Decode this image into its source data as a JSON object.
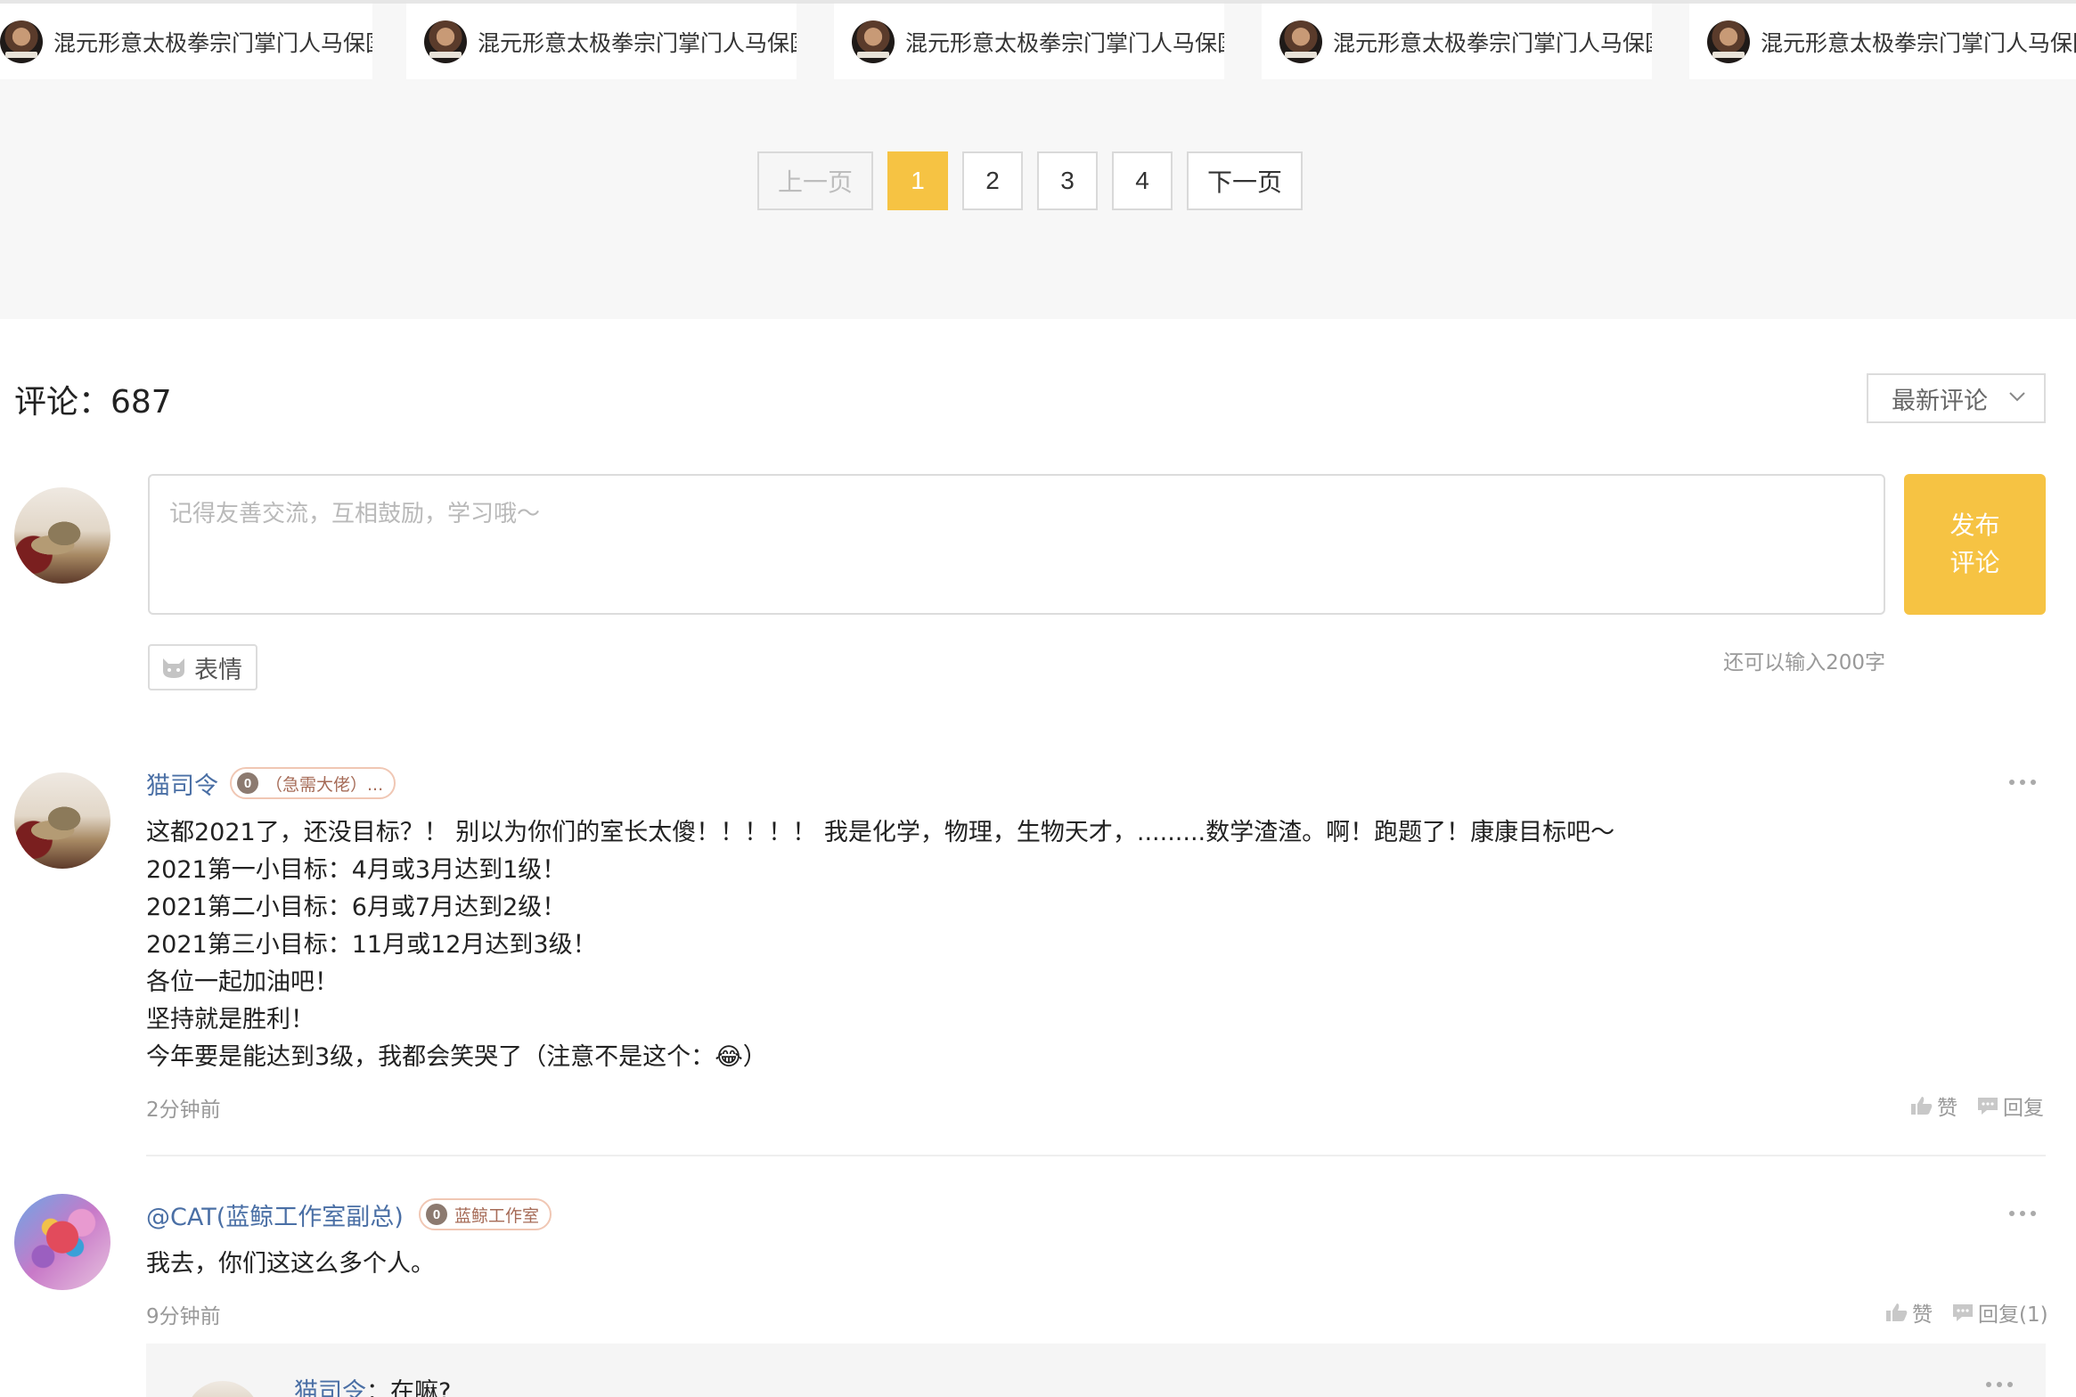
{
  "video_list": {
    "items": [
      {
        "title": "混元形意太极拳宗门掌门人马保国"
      },
      {
        "title": "混元形意太极拳宗门掌门人马保国"
      },
      {
        "title": "混元形意太极拳宗门掌门人马保国"
      },
      {
        "title": "混元形意太极拳宗门掌门人马保国"
      },
      {
        "title": "混元形意太极拳宗门掌门人马保国"
      }
    ]
  },
  "pagination": {
    "prev": "上一页",
    "pages": [
      "1",
      "2",
      "3",
      "4"
    ],
    "current": "1",
    "next": "下一页"
  },
  "comments_header": {
    "label": "评论：687",
    "sort_selected": "最新评论"
  },
  "composer": {
    "placeholder": "记得友善交流，互相鼓励，学习哦～",
    "publish_line1": "发布",
    "publish_line2": "评论",
    "emoji_label": "表情",
    "remaining": "还可以输入200字"
  },
  "comments": [
    {
      "author": "猫司令",
      "level": "0",
      "badge": "（急需大佬）...",
      "lines": [
        "这都2021了，还没目标？！ 别以为你们的室长太傻！！！！！ 我是化学，物理，生物天才，.........数学渣渣。啊！跑题了！康康目标吧～",
        "2021第一小目标：4月或3月达到1级！",
        "2021第二小目标：6月或7月达到2级！",
        "2021第三小目标：11月或12月达到3级！",
        "各位一起加油吧！",
        "坚持就是胜利！",
        "今年要是能达到3级，我都会笑哭了（注意不是这个：",
        "😂",
        "）"
      ],
      "time": "2分钟前",
      "like_label": "赞",
      "reply_label": "回复"
    },
    {
      "author": "@CAT(蓝鲸工作室副总)",
      "level": "0",
      "badge": "蓝鲸工作室",
      "lines": [
        "我去，你们这这么多个人。"
      ],
      "time": "9分钟前",
      "like_label": "赞",
      "reply_label": "回复(1)",
      "replies": [
        {
          "author": "猫司令",
          "text": "：在嘛?"
        }
      ]
    }
  ],
  "colors": {
    "accent": "#f6c343",
    "link": "#4a6fa5",
    "page_bg": "#f7f7f7"
  }
}
